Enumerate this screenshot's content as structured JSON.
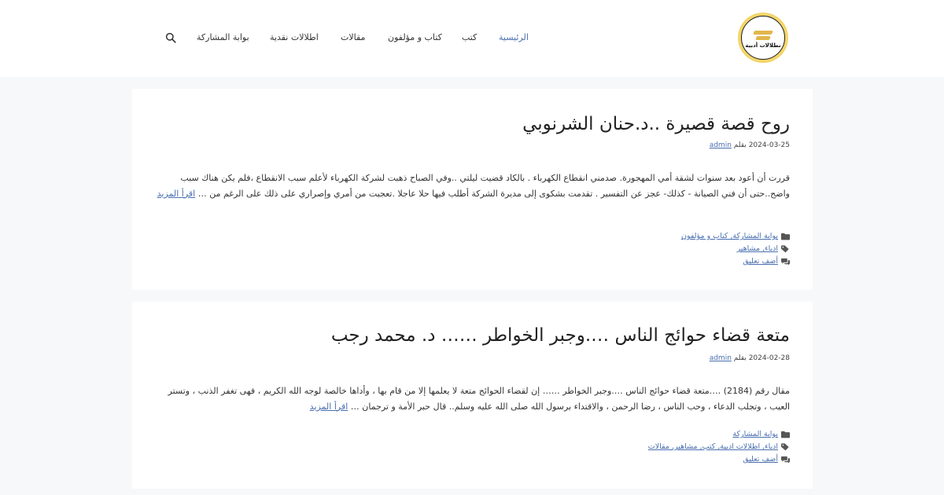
{
  "logo": {
    "text": "نطلالات أدبية"
  },
  "nav": {
    "items": [
      {
        "label": "الرئيسية",
        "active": true
      },
      {
        "label": "كتب"
      },
      {
        "label": "كتاب و مؤلفون"
      },
      {
        "label": "مقالات"
      },
      {
        "label": "اطلالات نقدية"
      },
      {
        "label": "بوابة المشاركة"
      }
    ],
    "search_icon": "search-icon"
  },
  "posts": [
    {
      "title": "روح قصة قصيرة ..د.حنان الشرنوبي",
      "date": "2024-03-25",
      "by": "بقلم",
      "author": "admin",
      "excerpt": "قررت أن أعود بعد سنوات لشقة أمي المهجورة. صدمني انقطاع الكهرباء . بالكاد قضيت ليلتي ..وفي الصباح ذهبت لشركة الكهرباء لأعلم سبب الانقطاع ،فلم يكن هناك سبب واضح..حتى أن فني الصيانة - كذلك- عجز عن التفسير . تقدمت بشكوى إلى مديرة الشركة أطلب فيها حلا عاجلا .تعجبت من أمري وإصراري على ذلك على الرغم من …",
      "read_more": "اقرأ المزيد",
      "categories": "بوابة المشاركة, كتاب و مؤلفون",
      "tags": "ادباء, مشاهير",
      "comment": "أضف تعليق"
    },
    {
      "title": "متعة قضاء حوائج الناس ….وجبر الخواطر …… د. محمد رجب",
      "date": "2024-02-28",
      "by": "بقلم",
      "author": "admin",
      "excerpt": "مقال رقم (2184) ….متعة قضاء حوائج الناس ….وجبر الخواطر …… إن لقضاء الحوائج متعة لا يعلمها إلا من قام بها ، وأداها خالصة لوجه الله الكريم ، فهى تغفر الذنب ، وتستر العيب ، وتجلب الدعاء ، وحب الناس ، رضا الرحمن ، والاقتداء برسول الله صلى الله عليه وسلم.. قال حبر الأمة و ترجمان …",
      "read_more": "اقرأ المزيد",
      "categories": "بوابة المشاركة",
      "tags": "ادباء, اطلالات ادبية, كتب, مشاهير, مقالات",
      "comment": "أضف تعليق"
    }
  ],
  "colors": {
    "accent": "#4a6fb0",
    "logo_gold": "#f3d56a",
    "background": "#f7f8f9"
  }
}
